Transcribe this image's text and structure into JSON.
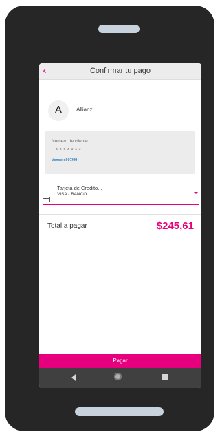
{
  "header": {
    "back_icon": "chevron-left",
    "title": "Confirmar tu pago"
  },
  "company": {
    "avatar_letter": "A",
    "name": "Allianz"
  },
  "client": {
    "label": "Numero de cliente",
    "number": "*******",
    "expiry": "Vence el 07/09"
  },
  "payment_method": {
    "icon": "credit-card-icon",
    "title": "Tarjeta de Credito...",
    "subtitle": "VISA - BANCO"
  },
  "total": {
    "label": "Total a pagar",
    "amount": "$245,61"
  },
  "pay_button": {
    "label": "Pagar"
  },
  "colors": {
    "accent": "#e6007e",
    "link": "#2a7ab8",
    "navbar": "#404040",
    "phone": "#262626"
  },
  "navbar": {
    "icons": [
      "back-triangle-icon",
      "home-circle-icon",
      "recent-square-icon"
    ]
  }
}
